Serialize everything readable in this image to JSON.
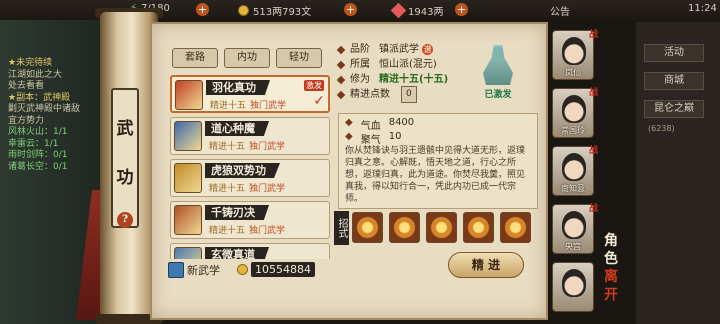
{
  "topbar": {
    "energy": "7/180",
    "coins": "513两793文",
    "ingots": "1943两",
    "announcement": "公告",
    "clock": "11:24"
  },
  "quest": {
    "lines": [
      {
        "text": "★未完待续",
        "style": "title"
      },
      {
        "text": "江湖如此之大",
        "style": "normal"
      },
      {
        "text": "处去看看",
        "style": "normal"
      },
      {
        "text": "★副本：武神殿",
        "style": "title"
      },
      {
        "text": "剿灭武神殿中诸敌",
        "style": "normal"
      },
      {
        "text": "宜方势力",
        "style": "normal"
      },
      {
        "text": "风林火山：1/1",
        "style": "green"
      },
      {
        "text": "幸雷云：1/1",
        "style": "green"
      },
      {
        "text": "雨时剑阵：0/1",
        "style": "green"
      },
      {
        "text": "诸葛长空：0/1",
        "style": "green"
      }
    ]
  },
  "scroll": {
    "title_chars": [
      "武",
      "功"
    ],
    "help_icon": "?"
  },
  "tabs": [
    "套路",
    "内功",
    "轻功"
  ],
  "skills": [
    {
      "name": "羽化真功",
      "level": "精进十五",
      "school": "独门武学",
      "selected": true,
      "active_badge": "激发",
      "icon_color": "#c0402a"
    },
    {
      "name": "道心种魔",
      "level": "精进十五",
      "school": "独门武学",
      "selected": false,
      "icon_color": "#3e6ab0"
    },
    {
      "name": "虎狼双势功",
      "level": "精进十五",
      "school": "独门武学",
      "selected": false,
      "icon_color": "#c08a2a"
    },
    {
      "name": "千铸刃决",
      "level": "精进十五",
      "school": "独门武学",
      "selected": false,
      "icon_color": "#b0502a"
    },
    {
      "name": "玄微真道",
      "level": "",
      "school": "",
      "selected": false,
      "icon_color": "#4a7ab0"
    }
  ],
  "bottom_left": {
    "new_skill_label": "新武学",
    "currency_total": "10554884"
  },
  "detail": {
    "grade_label": "品阶",
    "grade_value": "镇派武学",
    "grade_badge": "谱",
    "faction_label": "所属",
    "faction_value": "恒山派(混元)",
    "cultivation_label": "修为",
    "cultivation_value": "精进十五(十五)",
    "points_label": "精进点数",
    "points_value": "0",
    "state_label": "已激发",
    "stats": [
      {
        "label": "气血",
        "value": "8400"
      },
      {
        "label": "聚气",
        "value": "10"
      }
    ],
    "description": "你从焚锋诀与羽王遗骸中见得大道无形，返璞归真之意。心解既，悟天地之道，行心之所想，返璞归真，此为道途。你焚尽我羹，照见真我，得以知行合一，凭此内功已成一代宗师。",
    "moves_label": "招式",
    "practice_button": "精 进"
  },
  "sidebar_right": {
    "buttons": [
      "活动",
      "商城",
      "昆仑之巅"
    ],
    "server_note": "(6238)"
  },
  "characters": [
    {
      "name": "岚仙",
      "zhan": "战"
    },
    {
      "name": "常国玲",
      "zhan": "战"
    },
    {
      "name": "南知意",
      "zhan": "战"
    },
    {
      "name": "央宫",
      "zhan": "战"
    },
    {
      "name": "",
      "zhan": ""
    }
  ],
  "role_label": {
    "char1": "角",
    "char2": "色",
    "char3": "离",
    "char4": "开"
  }
}
